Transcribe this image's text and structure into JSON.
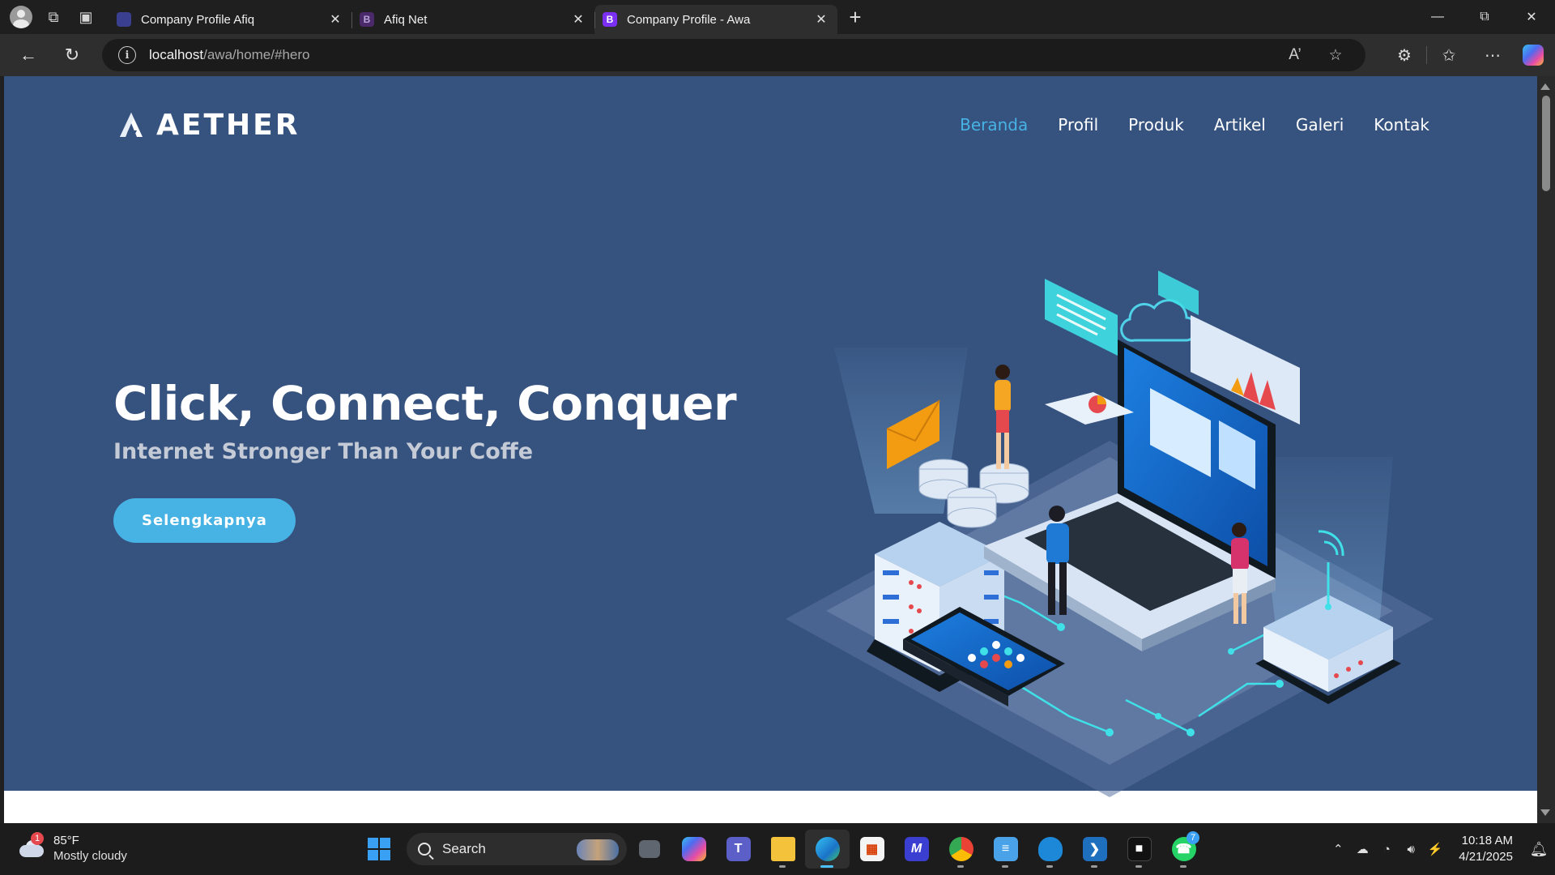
{
  "browser": {
    "tabs": [
      {
        "title": "Company Profile Afiq",
        "favicon": "app-favicon",
        "active": false
      },
      {
        "title": "Afiq Net",
        "favicon_letter": "B",
        "active": false
      },
      {
        "title": "Company Profile - Awa",
        "favicon_letter": "B",
        "active": true
      }
    ],
    "url_host": "localhost",
    "url_path": "/awa/home/#hero"
  },
  "site": {
    "brand": "AETHER",
    "nav": [
      "Beranda",
      "Profil",
      "Produk",
      "Artikel",
      "Galeri",
      "Kontak"
    ],
    "active_nav": "Beranda",
    "hero": {
      "title": "Click, Connect, Conquer",
      "subtitle": "Internet Stronger Than Your Coffe",
      "cta": "Selengkapnya"
    },
    "colors": {
      "hero_bg": "#36527f",
      "accent": "#47b2e4"
    }
  },
  "taskbar": {
    "weather": {
      "temp": "85°F",
      "condition": "Mostly cloudy",
      "badge": "1"
    },
    "search_label": "Search",
    "whatsapp_badge": "7",
    "time": "10:18 AM",
    "date": "4/21/2025"
  }
}
